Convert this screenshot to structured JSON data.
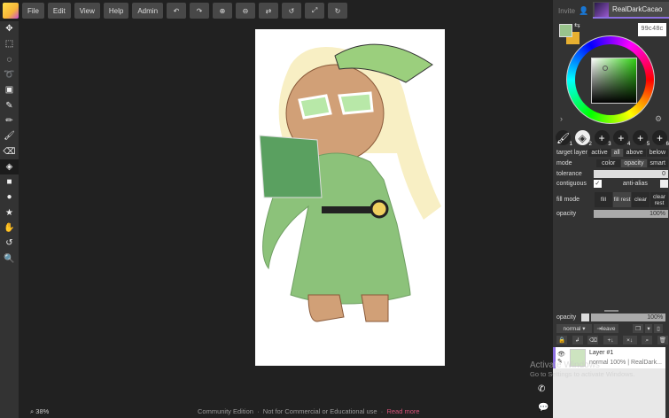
{
  "menu": {
    "items": [
      "File",
      "Edit",
      "View",
      "Help",
      "Admin"
    ],
    "icons": [
      "undo-icon",
      "redo-icon",
      "zoom-in-icon",
      "zoom-out-icon",
      "flip-icon",
      "rotate-left-icon",
      "fit-icon",
      "reset-rotate-icon"
    ]
  },
  "tools": [
    "move",
    "select-rect",
    "select-ellipse",
    "lasso",
    "transform",
    "eyedropper",
    "pen",
    "brush",
    "eraser",
    "fill",
    "rectangle",
    "ellipse",
    "shape",
    "hand",
    "rotate",
    "zoom"
  ],
  "header": {
    "invite": "Invite",
    "user": "RealDarkCacao"
  },
  "color": {
    "primary": "#99c48c",
    "secondary": "#e8b030",
    "hex": "99c48c"
  },
  "brush_slots": [
    "1",
    "2",
    "3",
    "4",
    "5",
    "6"
  ],
  "fill": {
    "target_layer_label": "target layer",
    "target_layer": [
      "active",
      "all",
      "above",
      "below"
    ],
    "mode_label": "mode",
    "mode": [
      "color",
      "opacity",
      "smart"
    ],
    "tolerance_label": "tolerance",
    "tolerance": "0",
    "contiguous_label": "contiguous",
    "antialias_label": "anti-alias",
    "fill_mode_label": "fill mode",
    "fill_mode": [
      "fill",
      "fill rest",
      "clear",
      "clear rest"
    ],
    "opacity_label": "opacity",
    "opacity": "100%"
  },
  "layers": {
    "opacity_label": "opacity",
    "opacity": "100%",
    "blend": "normal ▾",
    "leave": "leave",
    "items": [
      {
        "name": "Layer #1",
        "info": "normal 100% | RealDark..."
      }
    ]
  },
  "status": {
    "zoom": "38%",
    "edition": "Community Edition",
    "license": "Not for Commercial or Educational use",
    "read_more": "Read more"
  },
  "watermark": {
    "title": "Activate Windows",
    "sub": "Go to Settings to activate Windows."
  }
}
